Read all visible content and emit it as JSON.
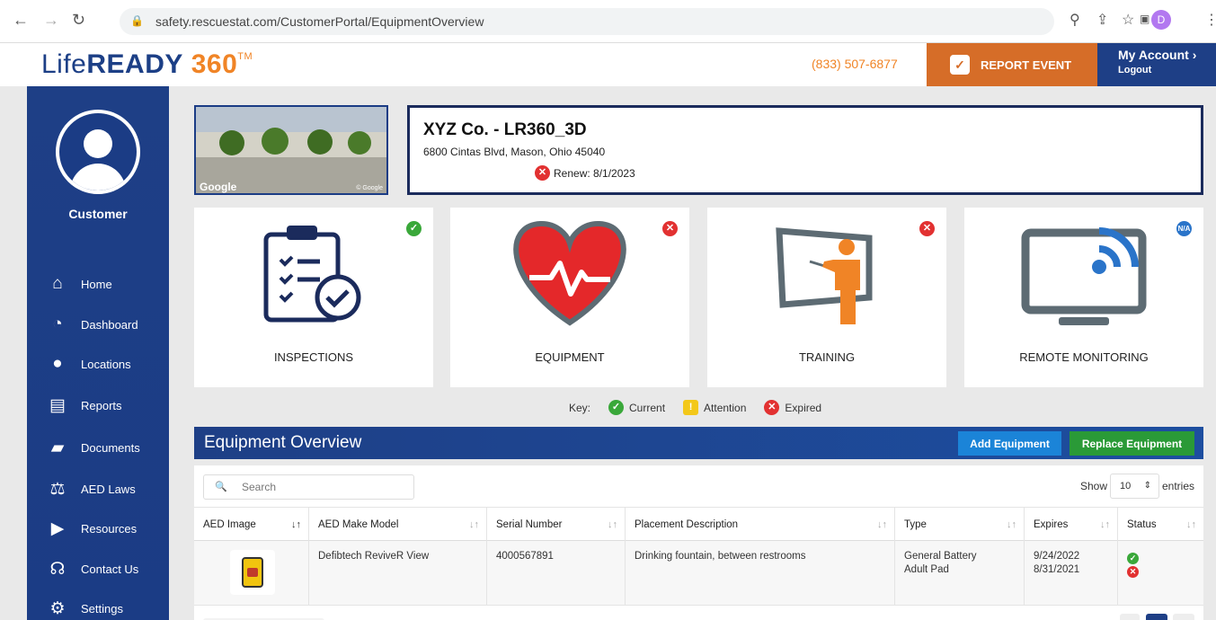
{
  "browser": {
    "url": "safety.rescuestat.com/CustomerPortal/EquipmentOverview",
    "profile_initial": "D"
  },
  "header": {
    "logo_light": "Life",
    "logo_bold": "READY",
    "logo_num": "360",
    "logo_tm": "TM",
    "phone": "(833) 507-6877",
    "report_event": "REPORT EVENT",
    "my_account": "My Account",
    "logout": "Logout"
  },
  "sidebar": {
    "user_label": "Customer",
    "items": [
      {
        "label": "Home",
        "icon": "home-icon"
      },
      {
        "label": "Dashboard",
        "icon": "dashboard-icon"
      },
      {
        "label": "Locations",
        "icon": "location-pin-icon"
      },
      {
        "label": "Reports",
        "icon": "reports-icon"
      },
      {
        "label": "Documents",
        "icon": "documents-icon"
      },
      {
        "label": "AED Laws",
        "icon": "scales-icon"
      },
      {
        "label": "Resources",
        "icon": "resources-icon"
      },
      {
        "label": "Contact Us",
        "icon": "headset-icon"
      },
      {
        "label": "Settings",
        "icon": "gears-icon"
      }
    ]
  },
  "location": {
    "photo_logo": "Google",
    "photo_copyright": "© Google",
    "name": "XYZ Co. - LR360_3D",
    "address": "6800 Cintas Blvd, Mason, Ohio 45040",
    "renew": "Renew: 8/1/2023"
  },
  "tiles": [
    {
      "label": "INSPECTIONS",
      "status": "current"
    },
    {
      "label": "EQUIPMENT",
      "status": "expired"
    },
    {
      "label": "TRAINING",
      "status": "expired"
    },
    {
      "label": "REMOTE MONITORING",
      "status": "na",
      "status_text": "N/A"
    }
  ],
  "key": {
    "label": "Key:",
    "current": "Current",
    "attention": "Attention",
    "expired": "Expired"
  },
  "equipment": {
    "title": "Equipment Overview",
    "add_button": "Add Equipment",
    "replace_button": "Replace Equipment",
    "search_placeholder": "Search",
    "show_label": "Show",
    "show_value": "10",
    "entries_label": "entries",
    "columns": [
      "AED Image",
      "AED Make Model",
      "Serial Number",
      "Placement Description",
      "Type",
      "Expires",
      "Status"
    ],
    "rows": [
      {
        "model": "Defibtech ReviveR View",
        "serial": "4000567891",
        "placement": "Drinking fountain, between restrooms",
        "type_1": "General Battery",
        "type_2": "Adult Pad",
        "expires_1": "9/24/2022",
        "expires_2": "8/31/2021",
        "status_1": "current",
        "status_2": "expired"
      }
    ]
  },
  "colors": {
    "brand_blue": "#1e3f86",
    "brand_orange": "#f08426",
    "report_orange": "#d66d28",
    "current_green": "#3aa83a",
    "expired_red": "#e23131",
    "attention_yellow": "#f3c81a",
    "add_blue": "#1b84d8",
    "replace_green": "#2a9a37"
  }
}
